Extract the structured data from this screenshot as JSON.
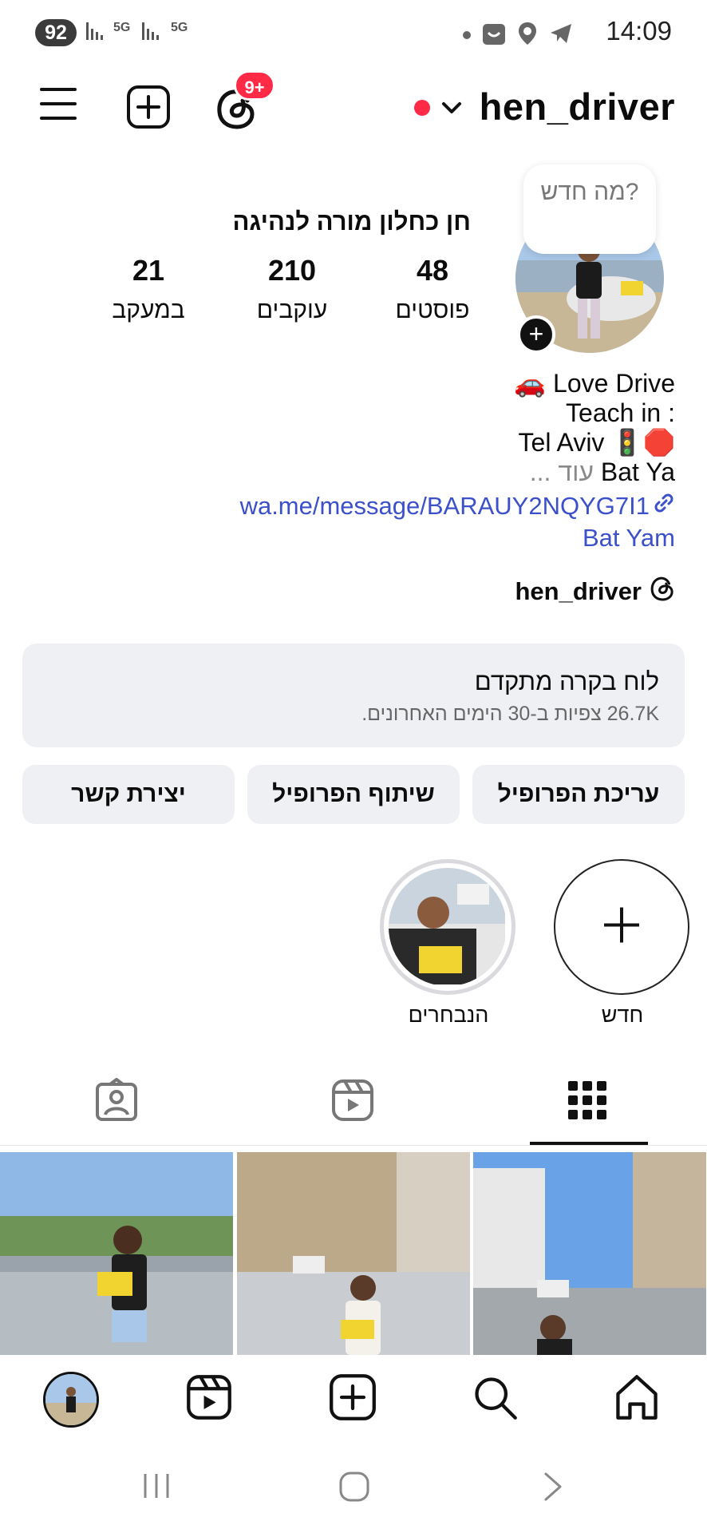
{
  "status_bar": {
    "battery": "92",
    "network1": "5G",
    "network2": "5G",
    "time": "14:09"
  },
  "header": {
    "username": "hen_driver",
    "notification_badge": "9+",
    "icons": [
      "menu-icon",
      "create-post-icon",
      "threads-icon",
      "account-switch-chevron-icon"
    ]
  },
  "profile": {
    "display_name": "חן כחלון מורה לנהיגה",
    "note_bubble": "מה חדש?",
    "stats": [
      {
        "value": "48",
        "label": "פוסטים"
      },
      {
        "value": "210",
        "label": "עוקבים"
      },
      {
        "value": "21",
        "label": "במעקב"
      }
    ],
    "bio_lines": [
      "🚗 Love Drive",
      "Teach in :",
      "Tel Aviv 🚦🛑",
      "Bat Ya"
    ],
    "bio_more": "... עוד",
    "link": "wa.me/message/BARAUY2NQYG7I1",
    "location": "Bat Yam",
    "threads_handle": "hen_driver"
  },
  "dashboard": {
    "title": "לוח בקרה מתקדם",
    "subtitle": "26.7K צפיות ב-30 הימים האחרונים."
  },
  "actions": {
    "edit": "עריכת הפרופיל",
    "share": "שיתוף הפרופיל",
    "contact": "יצירת קשר"
  },
  "highlights": [
    {
      "label": "חדש"
    },
    {
      "label": "הנבחרים"
    }
  ],
  "colors": {
    "accent_blue": "#3b50c9",
    "badge_red": "#ff2a46",
    "button_gray": "#eff0f3"
  }
}
